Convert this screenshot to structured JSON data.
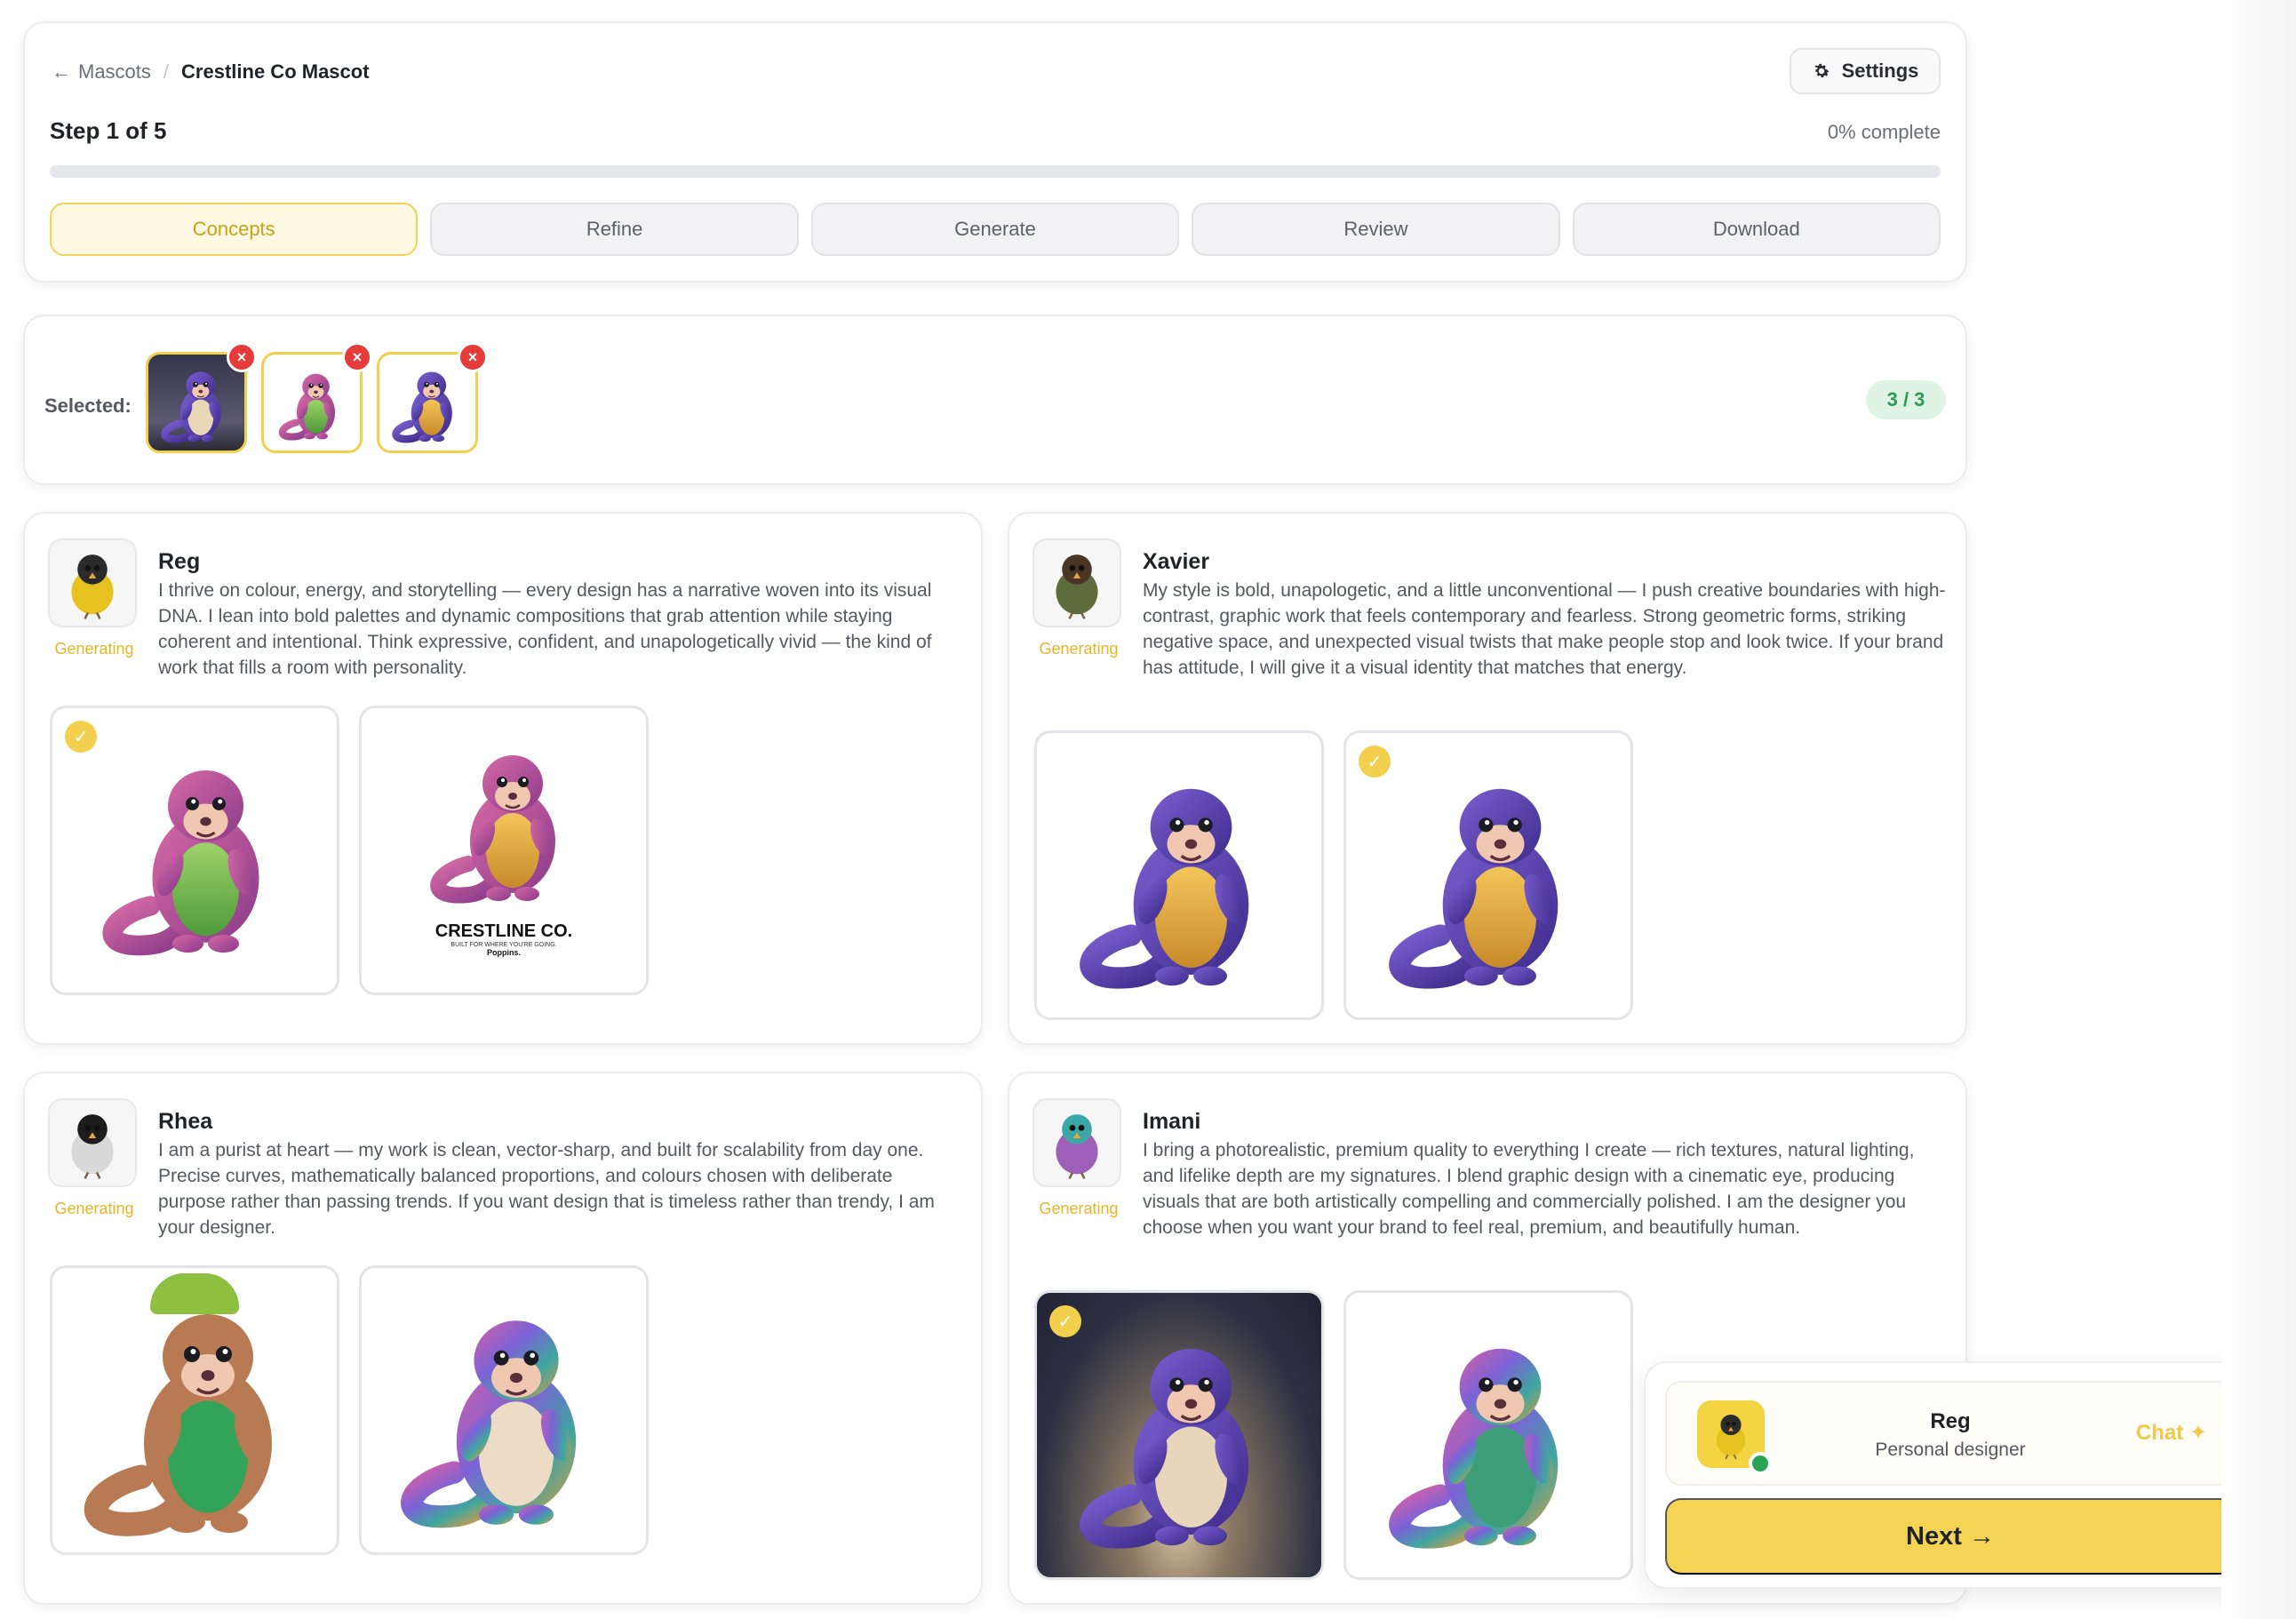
{
  "breadcrumb": {
    "back_label": "Mascots",
    "separator": "/",
    "current": "Crestline Co Mascot"
  },
  "header": {
    "settings_label": "Settings",
    "step_label": "Step 1 of 5",
    "progress_label": "0% complete",
    "progress_value": 0
  },
  "tabs": [
    {
      "label": "Concepts",
      "active": true
    },
    {
      "label": "Refine",
      "active": false
    },
    {
      "label": "Generate",
      "active": false
    },
    {
      "label": "Review",
      "active": false
    },
    {
      "label": "Download",
      "active": false
    }
  ],
  "selected": {
    "label": "Selected:",
    "count_label": "3 / 3",
    "remove_glyph": "×"
  },
  "designers": [
    {
      "name": "Reg",
      "status": "Generating",
      "bio": "I thrive on colour, energy, and storytelling — every design has a narrative woven into its visual DNA. I lean into bold palettes and dynamic compositions that grab attention while staying coherent and intentional. Think expressive, confident, and unapologetically vivid — the kind of work that fills a room with personality.",
      "images": [
        {
          "selected": true,
          "icon": "pangolin-waving-pink-green"
        },
        {
          "selected": false,
          "icon": "pangolin-backpack-pink-green",
          "caption": {
            "title": "CRESTLINE CO.",
            "tagline": "BUILT FOR WHERE YOU'RE GOING.",
            "font_note": "Poppins."
          }
        }
      ]
    },
    {
      "name": "Xavier",
      "status": "Generating",
      "bio": "My style is bold, unapologetic, and a little unconventional — I push creative boundaries with high-contrast, graphic work that feels contemporary and fearless. Strong geometric forms, striking negative space, and unexpected visual twists that make people stop and look twice. If your brand has attitude, I will give it a visual identity that matches that energy.",
      "images": [
        {
          "selected": false,
          "icon": "pangolin-purple-gold"
        },
        {
          "selected": true,
          "icon": "pangolin-purple-gold"
        }
      ]
    },
    {
      "name": "Rhea",
      "status": "Generating",
      "bio": "I am a purist at heart — my work is clean, vector-sharp, and built for scalability from day one. Precise curves, mathematically balanced proportions, and colours chosen with deliberate purpose rather than passing trends. If you want design that is timeless rather than trendy, I am your designer.",
      "images": [
        {
          "selected": false,
          "icon": "pangolin-green-beanie"
        },
        {
          "selected": false,
          "icon": "pangolin-rainbow-feathers"
        }
      ]
    },
    {
      "name": "Imani",
      "status": "Generating",
      "bio": "I bring a photorealistic, premium quality to everything I create — rich textures, natural lighting, and lifelike depth are my signatures. I blend graphic design with a cinematic eye, producing visuals that are both artistically compelling and commercially polished. I am the designer you choose when you want your brand to feel real, premium, and beautifully human.",
      "images": [
        {
          "selected": true,
          "icon": "pangolin-photoreal-dark"
        },
        {
          "selected": false,
          "icon": "pangolin-colorful-standing"
        }
      ]
    }
  ],
  "chat": {
    "name": "Reg",
    "role": "Personal designer",
    "chat_label": "Chat ✦",
    "next_label": "Next →"
  },
  "colors": {
    "accent": "#f5d354",
    "accent_text": "#c9a118",
    "status_generating": "#e6b527",
    "remove": "#e53b3b",
    "count_badge_bg": "#e0f4e6",
    "count_badge_text": "#2c9b54",
    "online": "#2aa452"
  }
}
